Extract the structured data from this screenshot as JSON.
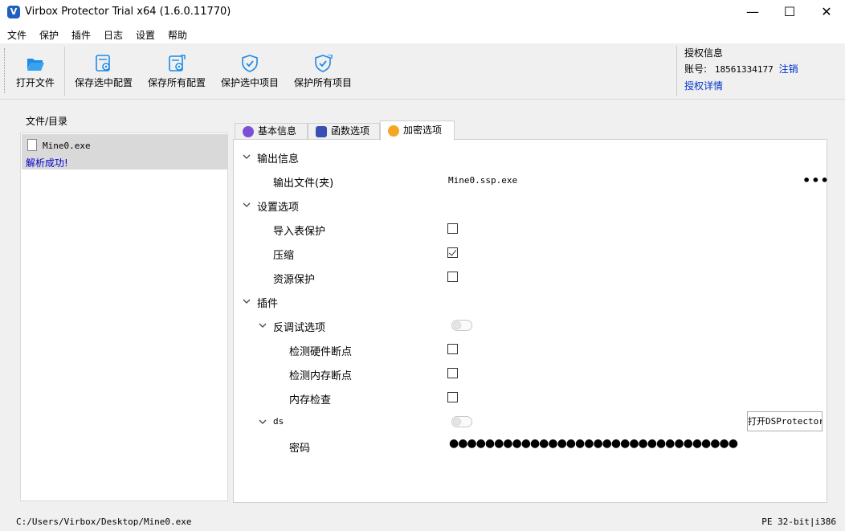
{
  "window": {
    "title": "Virbox Protector Trial x64  (1.6.0.11770)",
    "app_icon_letter": "V",
    "minimize": "—",
    "maximize": "☐",
    "close": "✕"
  },
  "menu": [
    "文件",
    "保护",
    "插件",
    "日志",
    "设置",
    "帮助"
  ],
  "toolbar": {
    "open_file": "打开文件",
    "save_selected_config": "保存选中配置",
    "save_all_config": "保存所有配置",
    "protect_selected": "保护选中项目",
    "protect_all": "保护所有项目"
  },
  "auth": {
    "title": "授权信息",
    "account_label": "账号:",
    "account_value": "18561334177",
    "logout": "注销",
    "details": "授权详情"
  },
  "files": {
    "group_label": "文件/目录",
    "items": [
      {
        "name": "Mine0.exe",
        "status": "解析成功!"
      }
    ]
  },
  "tabs": [
    {
      "label": "基本信息",
      "icon": "chat-bubble-icon",
      "color": "#7b4fd6"
    },
    {
      "label": "函数选项",
      "icon": "waveform-icon",
      "color": "#3a4fb5"
    },
    {
      "label": "加密选项",
      "icon": "lock-icon",
      "color": "#f5a623"
    }
  ],
  "active_tab": "加密选项",
  "sections": {
    "output": {
      "title": "输出信息",
      "output_file_label": "输出文件(夹)",
      "output_file_value": "Mine0.ssp.exe",
      "more": "•••"
    },
    "settings": {
      "title": "设置选项",
      "import_table_protection": {
        "label": "导入表保护",
        "checked": false
      },
      "compress": {
        "label": "压缩",
        "checked": true
      },
      "resource_protection": {
        "label": "资源保护",
        "checked": false
      }
    },
    "plugins": {
      "title": "插件",
      "anti_debug": {
        "label": "反调试选项",
        "enabled": false,
        "hw_breakpoint": {
          "label": "检测硬件断点",
          "checked": false
        },
        "mem_breakpoint": {
          "label": "检测内存断点",
          "checked": false
        },
        "mem_check": {
          "label": "内存检查",
          "checked": false
        }
      },
      "ds": {
        "label": "ds",
        "enabled": false,
        "open_button": "打开DSProtector",
        "password_label": "密码",
        "password_mask": "●●●●●●●●●●●●●●●●●●●●●●●●●●●●●●●●"
      }
    }
  },
  "status": {
    "path": "C:/Users/Virbox/Desktop/Mine0.exe",
    "arch": "PE 32-bit|i386"
  },
  "colors": {
    "accent": "#0033cc",
    "icon_blue": "#1e8ae6",
    "selection_gray": "#d9d9d9"
  }
}
